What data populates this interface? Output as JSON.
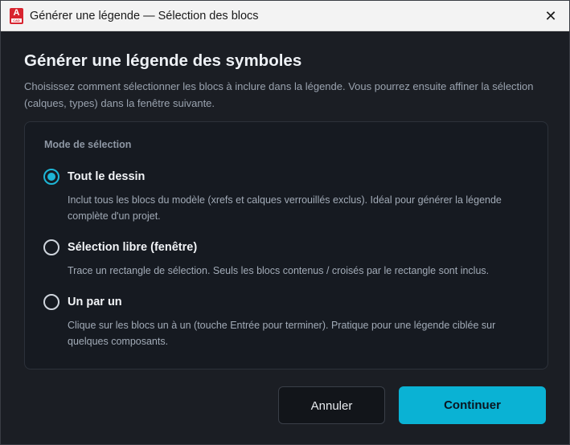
{
  "window": {
    "title": "Générer une légende — Sélection des blocs",
    "app_icon_letter": "A",
    "app_icon_badge": "CAD",
    "close_symbol": "✕"
  },
  "main": {
    "heading": "Générer une légende des symboles",
    "intro": "Choisissez comment sélectionner les blocs à inclure dans la légende. Vous pourrez ensuite affiner la sélection (calques, types) dans la fenêtre suivante."
  },
  "selection": {
    "label": "Mode de sélection",
    "options": [
      {
        "title": "Tout le dessin",
        "description": "Inclut tous les blocs du modèle (xrefs et calques verrouillés exclus). Idéal pour générer la légende complète d'un projet.",
        "checked": true
      },
      {
        "title": "Sélection libre (fenêtre)",
        "description": "Trace un rectangle de sélection. Seuls les blocs contenus / croisés par le rectangle sont inclus.",
        "checked": false
      },
      {
        "title": "Un par un",
        "description": "Clique sur les blocs un à un (touche Entrée pour terminer). Pratique pour une légende ciblée sur quelques composants.",
        "checked": false
      }
    ]
  },
  "buttons": {
    "cancel": "Annuler",
    "continue": "Continuer"
  },
  "colors": {
    "accent": "#0ab2d4",
    "background": "#1b1e24",
    "panel": "#161a21"
  }
}
